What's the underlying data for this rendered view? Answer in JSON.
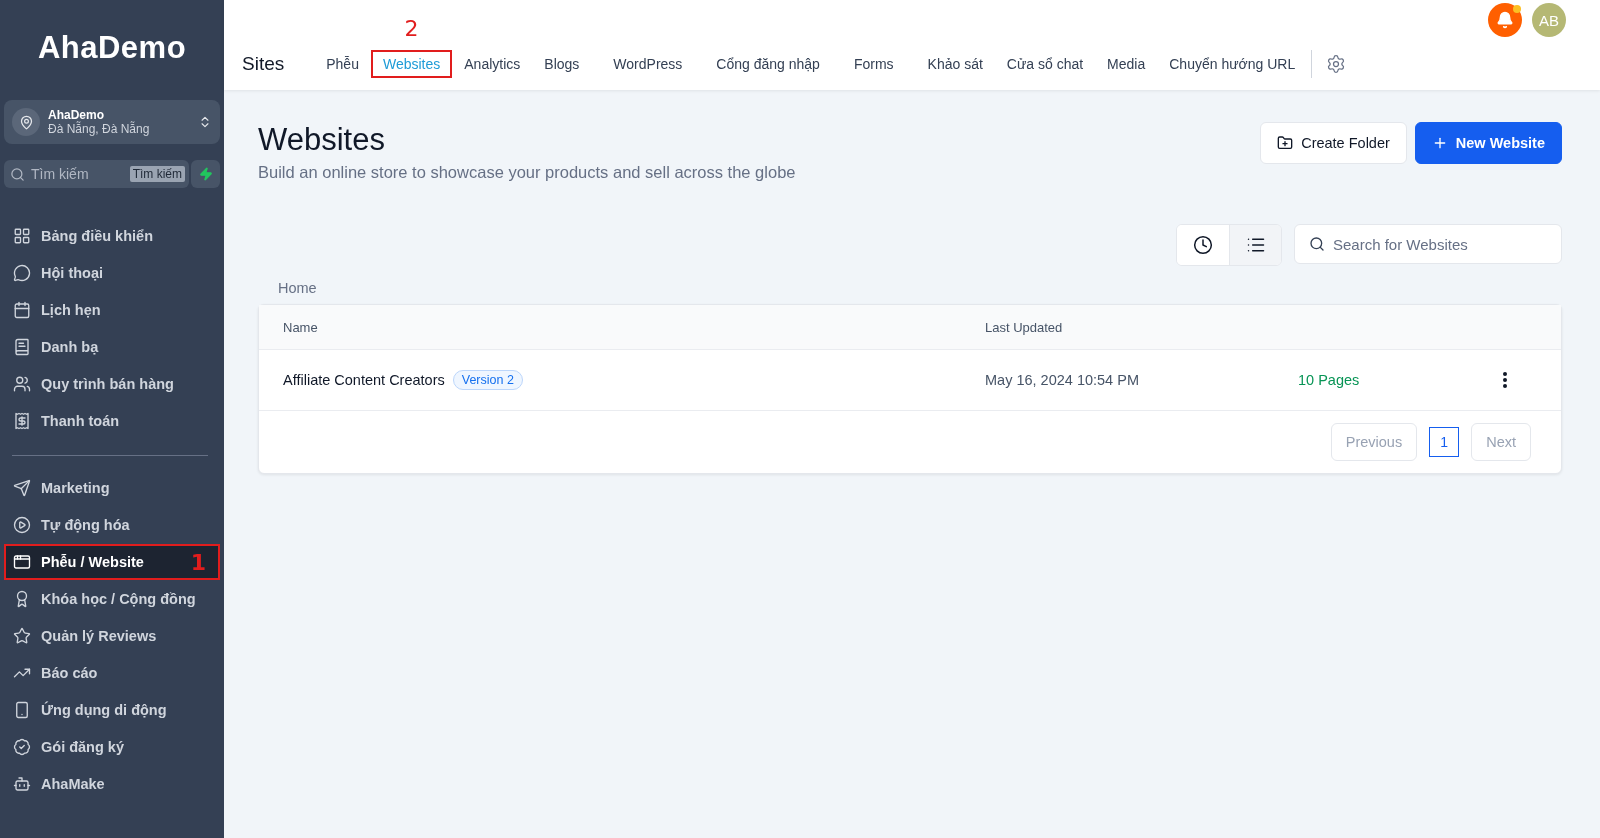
{
  "sidebar": {
    "logo": "AhaDemo",
    "account": {
      "name": "AhaDemo",
      "location": "Đà Nẵng, Đà Nẵng"
    },
    "search": {
      "placeholder": "Tìm kiếm",
      "shortcut": "Tìm kiếm"
    },
    "groups": [
      [
        {
          "label": "Bảng điều khiển",
          "selected": false
        },
        {
          "label": "Hội thoại",
          "selected": false
        },
        {
          "label": "Lịch hẹn",
          "selected": false
        },
        {
          "label": "Danh bạ",
          "selected": false
        },
        {
          "label": "Quy trình bán hàng",
          "selected": false
        },
        {
          "label": "Thanh toán",
          "selected": false
        }
      ],
      [
        {
          "label": "Marketing",
          "selected": false
        },
        {
          "label": "Tự động hóa",
          "selected": false
        },
        {
          "label": "Phễu / Website",
          "selected": true,
          "annotation": "1"
        },
        {
          "label": "Khóa học / Cộng đồng",
          "selected": false
        },
        {
          "label": "Quản lý Reviews",
          "selected": false
        },
        {
          "label": "Báo cáo",
          "selected": false
        },
        {
          "label": "Ứng dụng di động",
          "selected": false
        },
        {
          "label": "Gói đăng ký",
          "selected": false
        },
        {
          "label": "AhaMake",
          "selected": false
        }
      ]
    ]
  },
  "header": {
    "title": "Sites",
    "avatar": "AB",
    "notification_dot": true,
    "tabs": [
      {
        "label": "Phễu",
        "selected": false
      },
      {
        "label": "Websites",
        "selected": true,
        "annotation": "2"
      },
      {
        "label": "Analytics",
        "selected": false
      },
      {
        "label": "Blogs",
        "selected": false
      },
      {
        "label": "WordPress",
        "selected": false
      },
      {
        "label": "Cổng đăng nhập",
        "selected": false
      },
      {
        "label": "Forms",
        "selected": false
      },
      {
        "label": "Khảo sát",
        "selected": false
      },
      {
        "label": "Cửa sổ chat",
        "selected": false
      },
      {
        "label": "Media",
        "selected": false
      },
      {
        "label": "Chuyển hướng URL",
        "selected": false
      }
    ]
  },
  "page": {
    "title": "Websites",
    "subtitle": "Build an online store to showcase your products and sell across the globe",
    "buttons": [
      {
        "label": "Create Folder",
        "kind": "secondary"
      },
      {
        "label": "New Website",
        "kind": "primary"
      }
    ],
    "views": [
      {
        "selected": false
      },
      {
        "selected": true
      }
    ],
    "search": {
      "placeholder": "Search for Websites"
    },
    "breadcrumb": "Home",
    "table": {
      "columns": [
        "Name",
        "Last Updated"
      ],
      "rows": [
        {
          "name": "Affiliate Content Creators",
          "badge": "Version 2",
          "updated": "May 16, 2024 10:54 PM",
          "pages": "10 Pages"
        }
      ]
    },
    "pagination": {
      "previous": "Previous",
      "next": "Next",
      "pages": [
        {
          "label": "1",
          "selected": true
        }
      ]
    }
  }
}
